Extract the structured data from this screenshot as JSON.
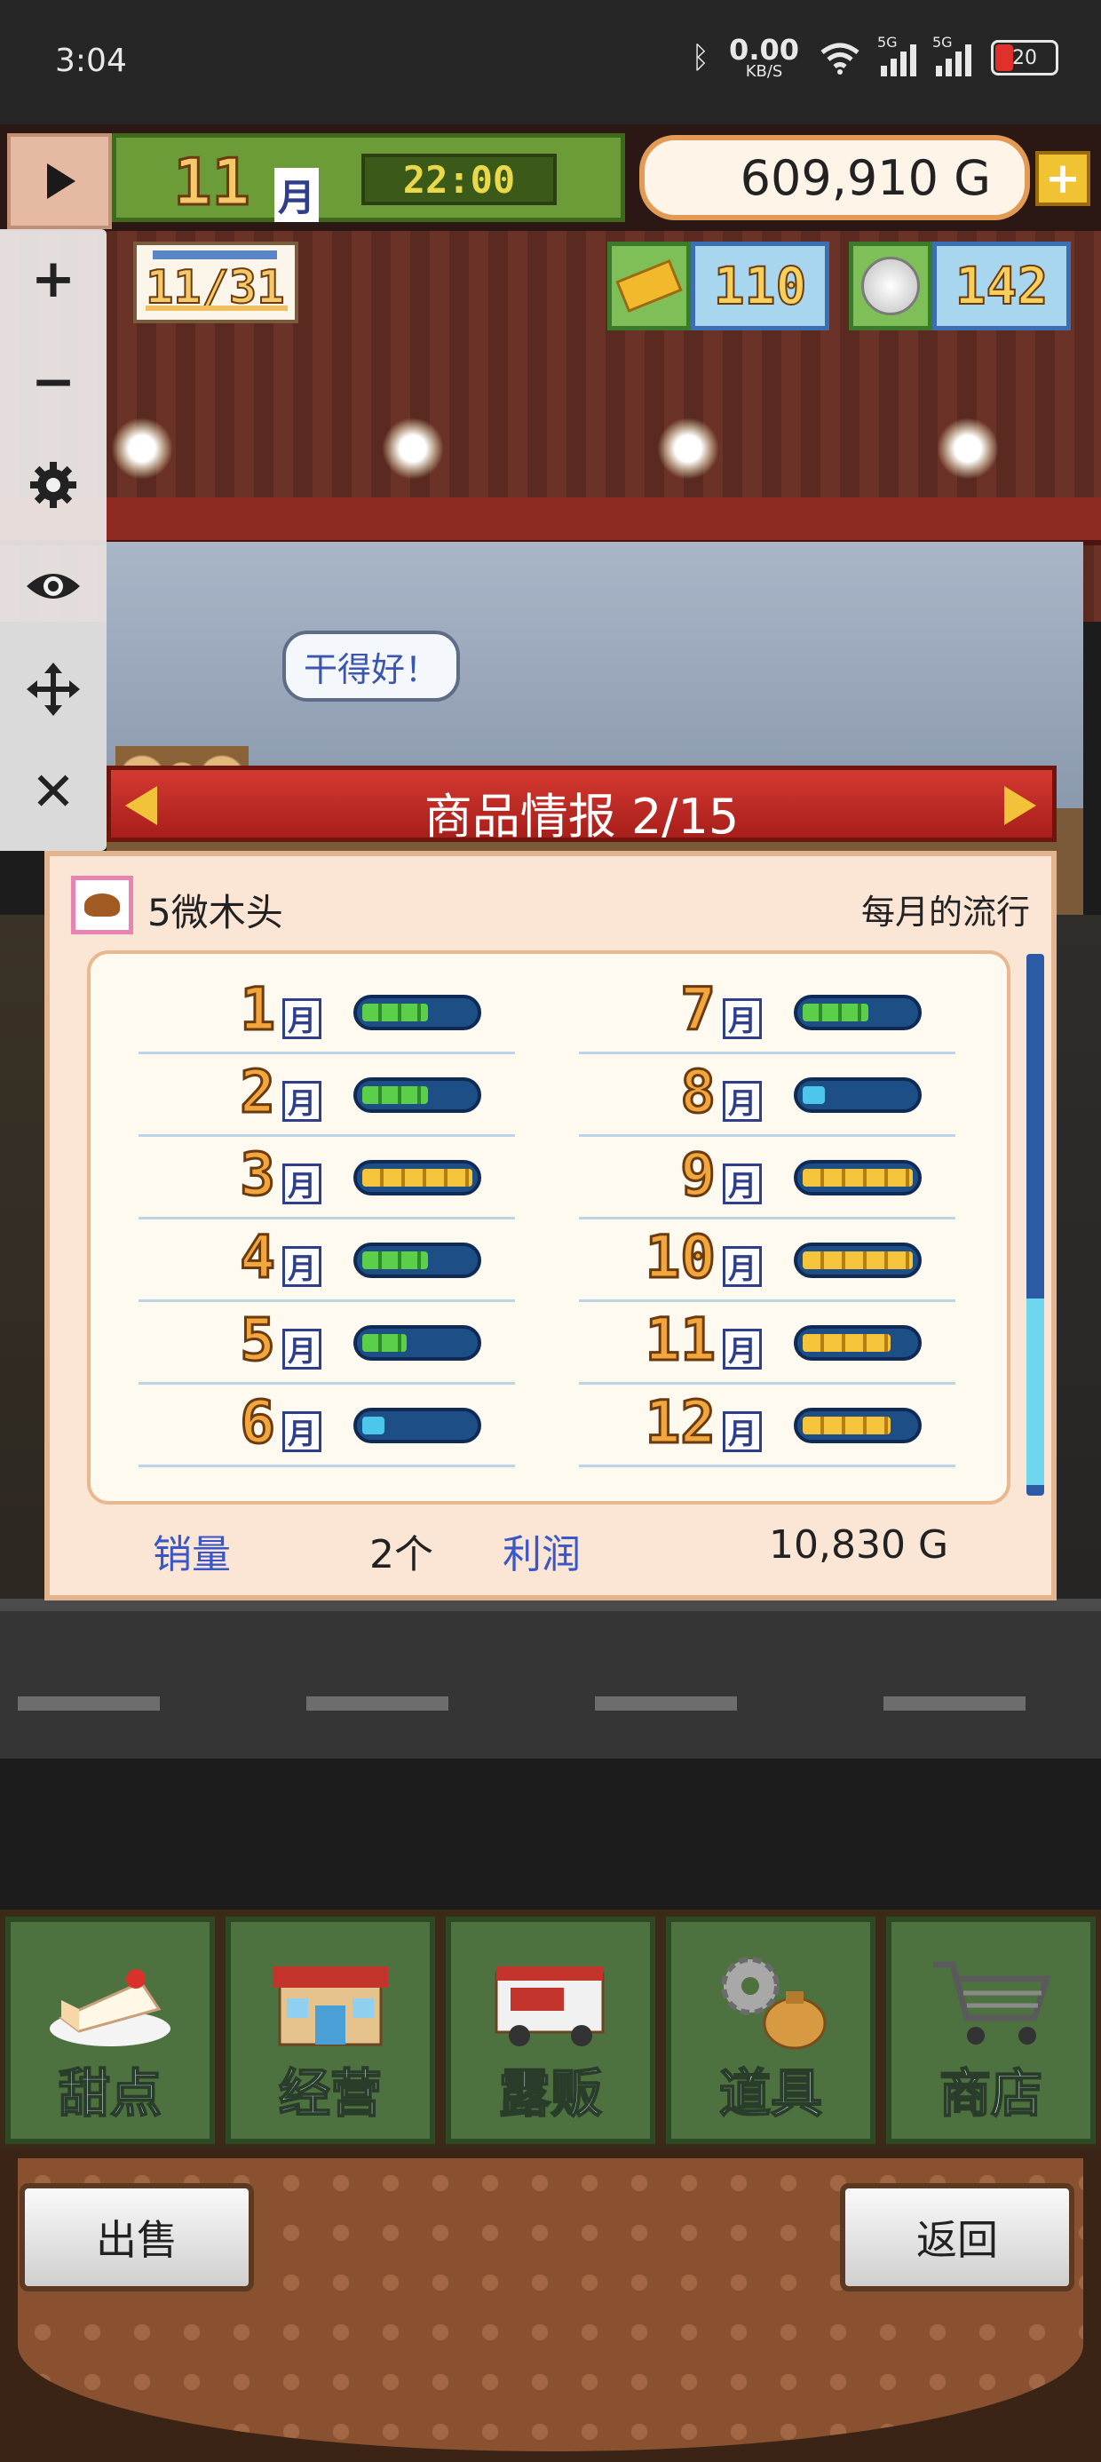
{
  "status_bar": {
    "time": "3:04",
    "net_speed": "0.00",
    "net_unit": "KB/S",
    "signal_1": "5G",
    "signal_2": "5G",
    "battery": "20"
  },
  "hud": {
    "month": "11",
    "month_unit": "月",
    "clock": "22:00",
    "money": "609,910 G",
    "date": "11/31",
    "gold": "110",
    "silver": "142"
  },
  "scene": {
    "speech_bubble": "干得好！"
  },
  "toolbar": {
    "play_icon": "play-icon",
    "zoom_in": "+",
    "zoom_out": "−",
    "close": "✕"
  },
  "panel": {
    "title": "商品情报 2/15",
    "product_name": "5微木头",
    "trend_label": "每月的流行",
    "month_unit": "月",
    "months": [
      {
        "month": "1",
        "level": 3,
        "color": "green"
      },
      {
        "month": "2",
        "level": 3,
        "color": "green"
      },
      {
        "month": "3",
        "level": 5,
        "color": "yellow"
      },
      {
        "month": "4",
        "level": 3,
        "color": "green"
      },
      {
        "month": "5",
        "level": 2,
        "color": "green"
      },
      {
        "month": "6",
        "level": 1,
        "color": "cyan"
      },
      {
        "month": "7",
        "level": 3,
        "color": "green"
      },
      {
        "month": "8",
        "level": 1,
        "color": "cyan"
      },
      {
        "month": "9",
        "level": 5,
        "color": "yellow"
      },
      {
        "month": "10",
        "level": 5,
        "color": "yellow"
      },
      {
        "month": "11",
        "level": 4,
        "color": "yellow"
      },
      {
        "month": "12",
        "level": 4,
        "color": "yellow"
      }
    ],
    "sales_label": "销量",
    "sales_value": "2个",
    "profit_label": "利润",
    "profit_value": "10,830 G"
  },
  "menu": {
    "items": [
      {
        "label": "甜点",
        "icon": "cake-icon"
      },
      {
        "label": "经营",
        "icon": "shop-building-icon"
      },
      {
        "label": "露贩",
        "icon": "food-truck-icon"
      },
      {
        "label": "道具",
        "icon": "gear-bag-icon"
      },
      {
        "label": "商店",
        "icon": "cart-icon"
      }
    ]
  },
  "actions": {
    "sell": "出售",
    "back": "返回"
  },
  "colors": {
    "panel_header": "#c0302a",
    "trend_green": "#5ccf4a",
    "trend_yellow": "#f6c43a",
    "menu_tile": "#4e7140"
  }
}
